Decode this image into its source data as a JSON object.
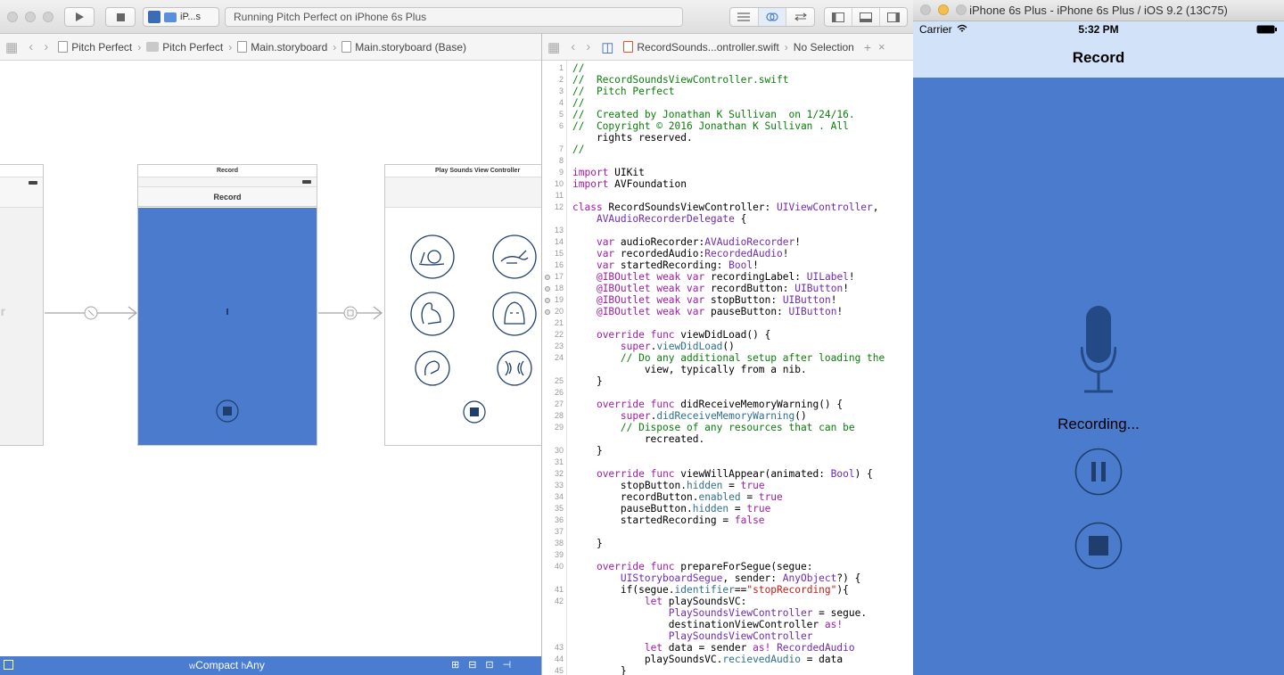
{
  "xcode": {
    "scheme": "iP...s",
    "activity": "Running Pitch Perfect on iPhone 6s Plus",
    "jumpbar_left": [
      "Pitch Perfect",
      "Pitch Perfect",
      "Main.storyboard",
      "Main.storyboard (Base)"
    ],
    "jumpbar_right": {
      "file": "RecordSounds...ontroller.swift",
      "selection": "No Selection"
    }
  },
  "storyboard": {
    "left_scene_fragment": "ller",
    "record_scene": {
      "status_title": "Record",
      "nav_title": "Record"
    },
    "play_scene": {
      "status_title": "Play Sounds View Controller"
    },
    "size_class": {
      "w_prefix": "w",
      "w_value": "Compact",
      "h_prefix": "h",
      "h_value": "Any"
    }
  },
  "code": {
    "lines": [
      {
        "n": "1",
        "t": "//"
      },
      {
        "n": "2",
        "t": "//  RecordSoundsViewController.swift"
      },
      {
        "n": "3",
        "t": "//  Pitch Perfect"
      },
      {
        "n": "4",
        "t": "//"
      },
      {
        "n": "5",
        "t": "//  Created by Jonathan K Sullivan  on 1/24/16."
      },
      {
        "n": "6",
        "t": "//  Copyright © 2016 Jonathan K Sullivan . All"
      },
      {
        "n": "",
        "t": "    rights reserved."
      },
      {
        "n": "7",
        "t": "//"
      },
      {
        "n": "8",
        "t": ""
      },
      {
        "n": "9",
        "t": "import UIKit"
      },
      {
        "n": "10",
        "t": "import AVFoundation"
      },
      {
        "n": "11",
        "t": ""
      },
      {
        "n": "12",
        "t": "class RecordSoundsViewController: UIViewController,"
      },
      {
        "n": "",
        "t": "    AVAudioRecorderDelegate {"
      },
      {
        "n": "13",
        "t": ""
      },
      {
        "n": "14",
        "t": "    var audioRecorder:AVAudioRecorder!"
      },
      {
        "n": "15",
        "t": "    var recordedAudio:RecordedAudio!"
      },
      {
        "n": "16",
        "t": "    var startedRecording: Bool!"
      },
      {
        "n": "17",
        "t": "    @IBOutlet weak var recordingLabel: UILabel!"
      },
      {
        "n": "18",
        "t": "    @IBOutlet weak var recordButton: UIButton!"
      },
      {
        "n": "19",
        "t": "    @IBOutlet weak var stopButton: UIButton!"
      },
      {
        "n": "20",
        "t": "    @IBOutlet weak var pauseButton: UIButton!"
      },
      {
        "n": "21",
        "t": ""
      },
      {
        "n": "22",
        "t": "    override func viewDidLoad() {"
      },
      {
        "n": "23",
        "t": "        super.viewDidLoad()"
      },
      {
        "n": "24",
        "t": "        // Do any additional setup after loading the"
      },
      {
        "n": "",
        "t": "            view, typically from a nib."
      },
      {
        "n": "25",
        "t": "    }"
      },
      {
        "n": "26",
        "t": ""
      },
      {
        "n": "27",
        "t": "    override func didReceiveMemoryWarning() {"
      },
      {
        "n": "28",
        "t": "        super.didReceiveMemoryWarning()"
      },
      {
        "n": "29",
        "t": "        // Dispose of any resources that can be"
      },
      {
        "n": "",
        "t": "            recreated."
      },
      {
        "n": "30",
        "t": "    }"
      },
      {
        "n": "31",
        "t": ""
      },
      {
        "n": "32",
        "t": "    override func viewWillAppear(animated: Bool) {"
      },
      {
        "n": "33",
        "t": "        stopButton.hidden = true"
      },
      {
        "n": "34",
        "t": "        recordButton.enabled = true"
      },
      {
        "n": "35",
        "t": "        pauseButton.hidden = true"
      },
      {
        "n": "36",
        "t": "        startedRecording = false"
      },
      {
        "n": "37",
        "t": ""
      },
      {
        "n": "38",
        "t": "    }"
      },
      {
        "n": "39",
        "t": ""
      },
      {
        "n": "40",
        "t": "    override func prepareForSegue(segue:"
      },
      {
        "n": "",
        "t": "        UIStoryboardSegue, sender: AnyObject?) {"
      },
      {
        "n": "41",
        "t": "        if(segue.identifier==\"stopRecording\"){"
      },
      {
        "n": "42",
        "t": "            let playSoundsVC:"
      },
      {
        "n": "",
        "t": "                PlaySoundsViewController = segue."
      },
      {
        "n": "",
        "t": "                destinationViewController as!"
      },
      {
        "n": "",
        "t": "                PlaySoundsViewController"
      },
      {
        "n": "43",
        "t": "            let data = sender as! RecordedAudio"
      },
      {
        "n": "44",
        "t": "            playSoundsVC.recievedAudio = data"
      },
      {
        "n": "45",
        "t": "        }"
      }
    ]
  },
  "simulator": {
    "window_title": "iPhone 6s Plus - iPhone 6s Plus / iOS 9.2 (13C75)",
    "carrier": "Carrier",
    "time": "5:32 PM",
    "nav_title": "Record",
    "recording_label": "Recording..."
  },
  "colors": {
    "accent": "#4b7bcd",
    "nav": "#d2e3f9",
    "dark_icon": "#1f3e6e",
    "size_bar": "#4a7dd0"
  },
  "icons": [
    "play-icon",
    "stop-icon",
    "microphone-icon",
    "pause-icon",
    "snail-icon",
    "rabbit-icon",
    "squirrel-icon",
    "ghost-icon",
    "reverb-icon",
    "echo-icon",
    "wifi-icon",
    "battery-icon"
  ]
}
